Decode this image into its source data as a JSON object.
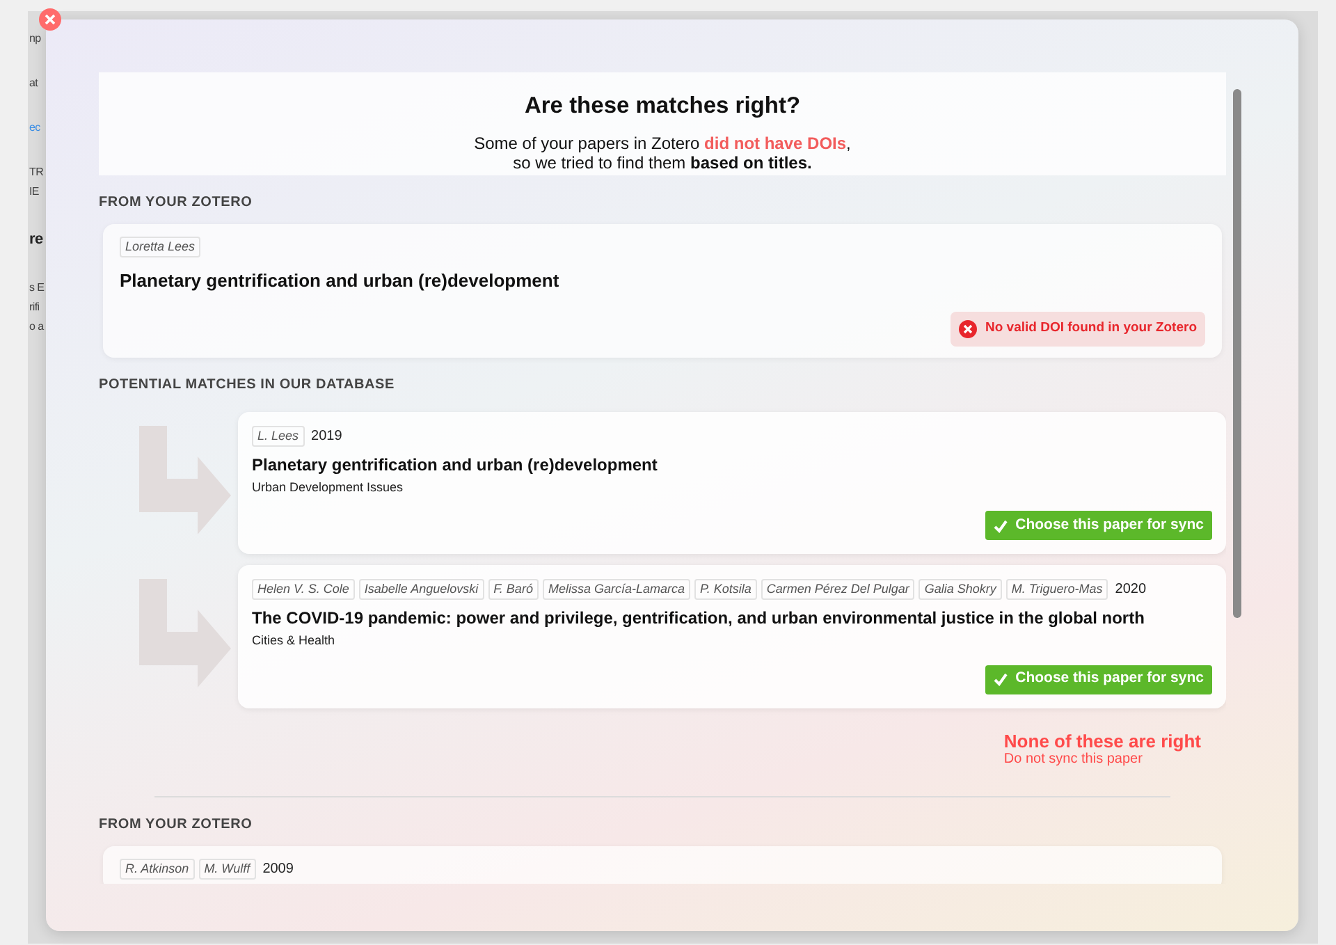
{
  "background_fragments": [
    {
      "text": "np",
      "kind": "plain"
    },
    {
      "text": "at",
      "kind": "plain"
    },
    {
      "text": "ec",
      "kind": "link"
    },
    {
      "text": "TR",
      "kind": "plain"
    },
    {
      "text": "IE",
      "kind": "plain"
    },
    {
      "text": "re",
      "kind": "heading"
    },
    {
      "text": "s E",
      "kind": "plain"
    },
    {
      "text": "rifi",
      "kind": "plain"
    },
    {
      "text": "o a",
      "kind": "plain"
    }
  ],
  "dialog": {
    "title": "Are these matches right?",
    "subtitle_lines": [
      [
        {
          "text": "Some of your papers in Zotero ",
          "kind": "plain"
        },
        {
          "text": "did not have DOIs",
          "kind": "alert"
        },
        {
          "text": ",",
          "kind": "plain"
        }
      ],
      [
        {
          "text": "so we tried to find them ",
          "kind": "plain"
        },
        {
          "text": "based on titles.",
          "kind": "bold"
        }
      ]
    ]
  },
  "groups": [
    {
      "source_label": "FROM YOUR ZOTERO",
      "source": {
        "authors": [
          "Loretta Lees"
        ],
        "title": "Planetary gentrification and urban (re)development",
        "status": "No valid DOI found in your Zotero"
      },
      "matches_label": "POTENTIAL MATCHES IN OUR DATABASE",
      "matches": [
        {
          "authors": [
            "L. Lees"
          ],
          "year": "2019",
          "title": "Planetary gentrification and urban (re)development",
          "journal": "Urban Development Issues",
          "action": "Choose this paper for sync"
        },
        {
          "authors": [
            "Helen V. S. Cole",
            "Isabelle Anguelovski",
            "F. Baró",
            "Melissa García-Lamarca",
            "P. Kotsila",
            "Carmen Pérez Del Pulgar",
            "Galia Shokry",
            "M. Triguero-Mas"
          ],
          "year": "2020",
          "title": "The COVID-19 pandemic: power and privilege, gentrification, and urban environmental justice in the global north",
          "journal": "Cities & Health",
          "action": "Choose this paper for sync"
        }
      ],
      "reject": {
        "title": "None of these are right",
        "subtitle": "Do not sync this paper"
      }
    },
    {
      "source_label": "FROM YOUR ZOTERO",
      "source": {
        "authors": [
          "R. Atkinson",
          "M. Wulff"
        ],
        "year": "2009"
      }
    }
  ]
}
